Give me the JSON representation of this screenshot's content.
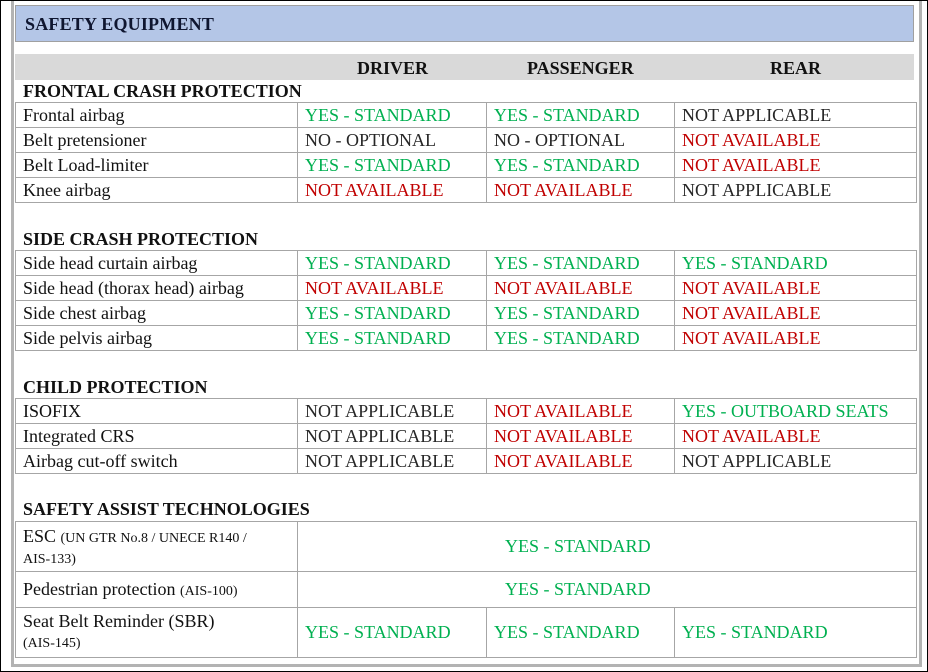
{
  "title": "SAFETY EQUIPMENT",
  "columns": {
    "driver": "DRIVER",
    "passenger": "PASSENGER",
    "rear": "REAR"
  },
  "colors": {
    "title_bar": "#b4c6e7",
    "column_header": "#d9d9d9",
    "yes": "#00b050",
    "not_available": "#c00000",
    "neutral": "#262626"
  },
  "sections": [
    {
      "title": "FRONTAL CRASH PROTECTION",
      "rows": [
        {
          "label": "Frontal airbag",
          "driver": "YES - STANDARD",
          "passenger": "YES - STANDARD",
          "rear": "NOT APPLICABLE"
        },
        {
          "label": "Belt pretensioner",
          "driver": "NO - OPTIONAL",
          "passenger": "NO - OPTIONAL",
          "rear": "NOT AVAILABLE"
        },
        {
          "label": "Belt Load-limiter",
          "driver": "YES - STANDARD",
          "passenger": "YES - STANDARD",
          "rear": "NOT AVAILABLE"
        },
        {
          "label": "Knee airbag",
          "driver": "NOT AVAILABLE",
          "passenger": "NOT AVAILABLE",
          "rear": "NOT APPLICABLE"
        }
      ]
    },
    {
      "title": "SIDE CRASH PROTECTION",
      "rows": [
        {
          "label": "Side head curtain airbag",
          "driver": "YES - STANDARD",
          "passenger": "YES - STANDARD",
          "rear": "YES - STANDARD"
        },
        {
          "label": "Side head (thorax head) airbag",
          "driver": "NOT AVAILABLE",
          "passenger": "NOT AVAILABLE",
          "rear": "NOT AVAILABLE"
        },
        {
          "label": "Side chest airbag",
          "driver": "YES - STANDARD",
          "passenger": "YES - STANDARD",
          "rear": "NOT AVAILABLE"
        },
        {
          "label": "Side pelvis airbag",
          "driver": "YES - STANDARD",
          "passenger": "YES - STANDARD",
          "rear": "NOT AVAILABLE"
        }
      ]
    },
    {
      "title": "CHILD PROTECTION",
      "rows": [
        {
          "label": "ISOFIX",
          "driver": "NOT APPLICABLE",
          "passenger": "NOT AVAILABLE",
          "rear": "YES - OUTBOARD SEATS"
        },
        {
          "label": "Integrated CRS",
          "driver": "NOT APPLICABLE",
          "passenger": "NOT AVAILABLE",
          "rear": "NOT AVAILABLE"
        },
        {
          "label": "Airbag cut-off switch",
          "driver": "NOT APPLICABLE",
          "passenger": "NOT AVAILABLE",
          "rear": "NOT APPLICABLE"
        }
      ]
    },
    {
      "title": "SAFETY ASSIST TECHNOLOGIES",
      "rows": [
        {
          "label": "ESC",
          "label_note": "(UN GTR No.8 / UNECE R140 /",
          "label_note2": "AIS-133)",
          "all": "YES - STANDARD"
        },
        {
          "label": "Pedestrian protection",
          "label_note": "(AIS-100)",
          "all": "YES - STANDARD"
        },
        {
          "label": "Seat Belt Reminder (SBR)",
          "label_note": "(AIS-145)",
          "driver": "YES - STANDARD",
          "passenger": "YES - STANDARD",
          "rear": "YES - STANDARD"
        }
      ]
    }
  ]
}
